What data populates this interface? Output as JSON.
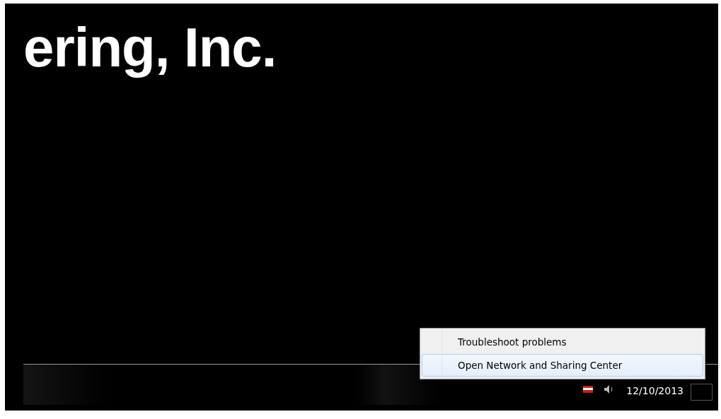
{
  "desktop": {
    "wallpaper_text": "ering, Inc."
  },
  "context_menu": {
    "items": [
      {
        "label": "Troubleshoot problems",
        "selected": false
      },
      {
        "label": "Open Network and Sharing Center",
        "selected": true
      }
    ]
  },
  "taskbar": {
    "date": "12/10/2013"
  }
}
